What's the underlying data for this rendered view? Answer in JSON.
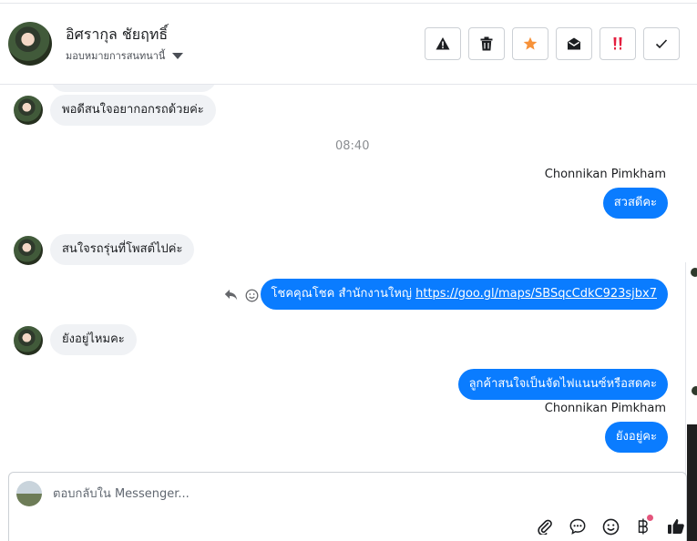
{
  "header": {
    "contact_name": "อิศรากุล ชัยฤทธิ์",
    "assign_label": "มอบหมายการสนทนานี้",
    "actions": [
      {
        "name": "spam-button",
        "icon": "warning-icon"
      },
      {
        "name": "delete-button",
        "icon": "trash-icon"
      },
      {
        "name": "star-button",
        "icon": "star-icon"
      },
      {
        "name": "mark-unread-button",
        "icon": "envelope-open-icon"
      },
      {
        "name": "follow-up-button",
        "icon": "exclamation-icon"
      },
      {
        "name": "done-button",
        "icon": "check-icon"
      }
    ]
  },
  "messages": {
    "m1": "พอดีสนใจอยากอกรถด้วยค่ะ",
    "time1": "08:40",
    "sender1": "Chonnikan Pimkham",
    "m2": "สวสดีคะ",
    "m3": "สนใจรถรุ่นที่โพสต์ไปค่ะ",
    "m4_prefix": "โชคคุณโชค สำนักงานใหญ่",
    "m4_link": "https://goo.gl/maps/SBSqcCdkC923sjbx7",
    "m5": "ยังอยู่ไหมคะ",
    "m6": "ลูกค้าสนใจเป็นจัดไฟแนนซ์หรือสดคะ",
    "sender2": "Chonnikan Pimkham",
    "m7": "ยังอยู่คะ"
  },
  "composer": {
    "placeholder": "ตอบกลับใน Messenger..."
  },
  "colors": {
    "outgoing": "#0a7cff",
    "incoming": "#f0f2f5",
    "star": "#f7923a",
    "alert": "#e41e3f"
  }
}
